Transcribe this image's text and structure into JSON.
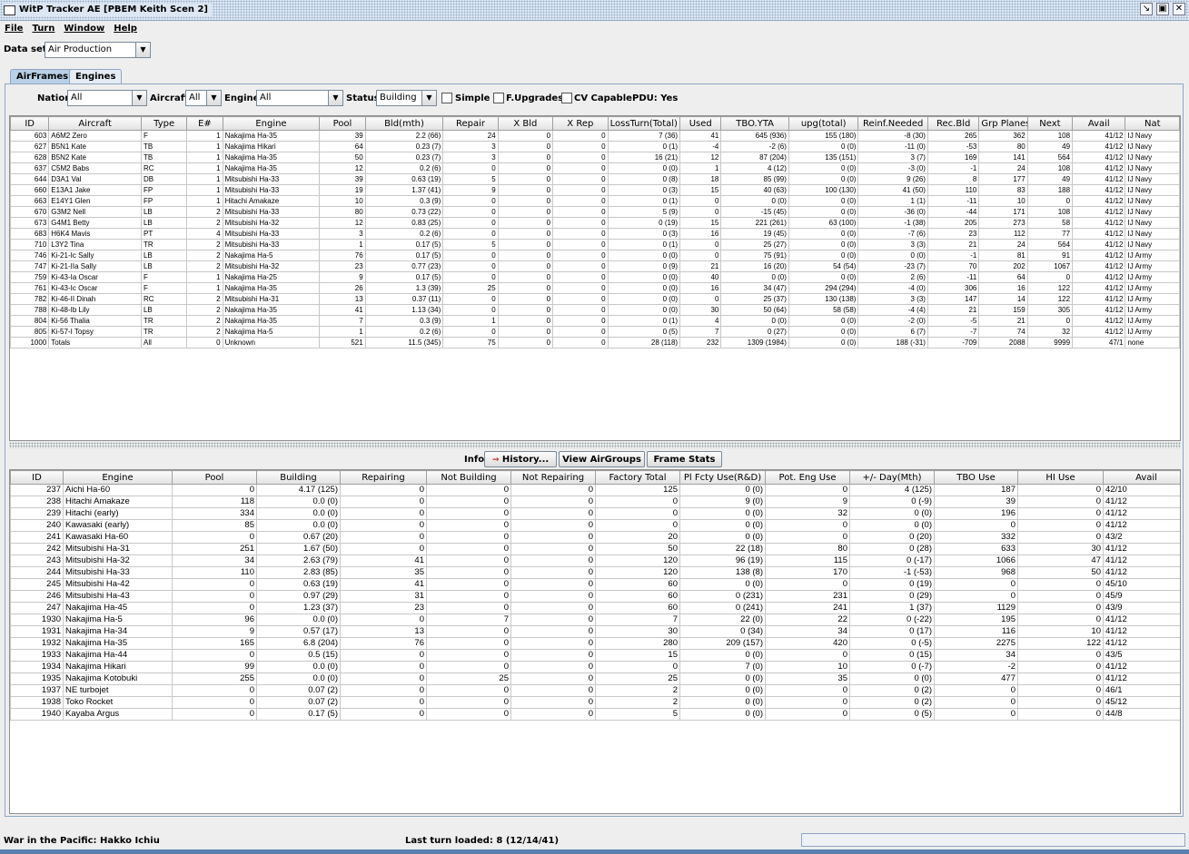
{
  "window": {
    "title": "WitP Tracker AE [PBEM Keith Scen 2]"
  },
  "menu": [
    "File",
    "Turn",
    "Window",
    "Help"
  ],
  "dataset": {
    "label": "Data set:",
    "value": "Air Production"
  },
  "tabs": [
    "AirFrames",
    "Engines"
  ],
  "filters": {
    "nation_label": "Nation:",
    "nation_value": "All",
    "aircraft_label": "Aircraft:",
    "aircraft_value": "All",
    "engine_label": "Engine:",
    "engine_value": "All",
    "status_label": "Status:",
    "status_value": "Building",
    "simple": "Simple",
    "fupgrades": "F.Upgrades",
    "cvcapable": "CV Capable",
    "pdu": "PDU: Yes"
  },
  "airframes": {
    "columns": [
      "ID",
      "Aircraft",
      "Type",
      "E#",
      "Engine",
      "Pool",
      "Bld(mth)",
      "Repair",
      "X Bld",
      "X Rep",
      "LossTurn(Total)",
      "Used",
      "TBO.YTA",
      "upg(total)",
      "Reinf.Needed",
      "Rec.Bld",
      "Grp Planes",
      "Next",
      "Avail",
      "Nat"
    ],
    "rows": [
      [
        "603",
        "A6M2 Zero",
        "F",
        "1",
        "Nakajima Ha-35",
        "39",
        "2.2 (66)",
        "24",
        "0",
        "0",
        "7 (36)",
        "41",
        "645 (936)",
        "155 (180)",
        "-8 (30)",
        "265",
        "362",
        "108",
        "41/12",
        "IJ Navy"
      ],
      [
        "627",
        "B5N1 Kate",
        "TB",
        "1",
        "Nakajima Hikari",
        "64",
        "0.23 (7)",
        "3",
        "0",
        "0",
        "0 (1)",
        "-4",
        "-2 (6)",
        "0 (0)",
        "-11 (0)",
        "-53",
        "80",
        "49",
        "41/12",
        "IJ Navy"
      ],
      [
        "628",
        "B5N2 Kate",
        "TB",
        "1",
        "Nakajima Ha-35",
        "50",
        "0.23 (7)",
        "3",
        "0",
        "0",
        "16 (21)",
        "12",
        "87 (204)",
        "135 (151)",
        "3 (7)",
        "169",
        "141",
        "564",
        "41/12",
        "IJ Navy"
      ],
      [
        "637",
        "C5M2 Babs",
        "RC",
        "1",
        "Nakajima Ha-35",
        "12",
        "0.2 (6)",
        "0",
        "0",
        "0",
        "0 (0)",
        "1",
        "4 (12)",
        "0 (0)",
        "-3 (0)",
        "-1",
        "24",
        "108",
        "41/12",
        "IJ Navy"
      ],
      [
        "644",
        "D3A1 Val",
        "DB",
        "1",
        "Mitsubishi Ha-33",
        "39",
        "0.63 (19)",
        "5",
        "0",
        "0",
        "0 (8)",
        "18",
        "85 (99)",
        "0 (0)",
        "9 (26)",
        "8",
        "177",
        "49",
        "41/12",
        "IJ Navy"
      ],
      [
        "660",
        "E13A1 Jake",
        "FP",
        "1",
        "Mitsubishi Ha-33",
        "19",
        "1.37 (41)",
        "9",
        "0",
        "0",
        "0 (3)",
        "15",
        "40 (63)",
        "100 (130)",
        "41 (50)",
        "110",
        "83",
        "188",
        "41/12",
        "IJ Navy"
      ],
      [
        "663",
        "E14Y1 Glen",
        "FP",
        "1",
        "Hitachi Amakaze",
        "10",
        "0.3 (9)",
        "0",
        "0",
        "0",
        "0 (1)",
        "0",
        "0 (0)",
        "0 (0)",
        "1 (1)",
        "-11",
        "10",
        "0",
        "41/12",
        "IJ Navy"
      ],
      [
        "670",
        "G3M2 Nell",
        "LB",
        "2",
        "Mitsubishi Ha-33",
        "80",
        "0.73 (22)",
        "0",
        "0",
        "0",
        "5 (9)",
        "0",
        "-15 (45)",
        "0 (0)",
        "-36 (0)",
        "-44",
        "171",
        "108",
        "41/12",
        "IJ Navy"
      ],
      [
        "673",
        "G4M1 Betty",
        "LB",
        "2",
        "Mitsubishi Ha-32",
        "12",
        "0.83 (25)",
        "0",
        "0",
        "0",
        "0 (19)",
        "15",
        "221 (261)",
        "63 (100)",
        "-1 (38)",
        "205",
        "273",
        "58",
        "41/12",
        "IJ Navy"
      ],
      [
        "683",
        "H6K4 Mavis",
        "PT",
        "4",
        "Mitsubishi Ha-33",
        "3",
        "0.2 (6)",
        "0",
        "0",
        "0",
        "0 (3)",
        "16",
        "19 (45)",
        "0 (0)",
        "-7 (6)",
        "23",
        "112",
        "77",
        "41/12",
        "IJ Navy"
      ],
      [
        "710",
        "L3Y2 Tina",
        "TR",
        "2",
        "Mitsubishi Ha-33",
        "1",
        "0.17 (5)",
        "5",
        "0",
        "0",
        "0 (1)",
        "0",
        "25 (27)",
        "0 (0)",
        "3 (3)",
        "21",
        "24",
        "564",
        "41/12",
        "IJ Navy"
      ],
      [
        "746",
        "Ki-21-Ic Sally",
        "LB",
        "2",
        "Nakajima Ha-5",
        "76",
        "0.17 (5)",
        "0",
        "0",
        "0",
        "0 (0)",
        "0",
        "75 (91)",
        "0 (0)",
        "0 (0)",
        "-1",
        "81",
        "91",
        "41/12",
        "IJ Army"
      ],
      [
        "747",
        "Ki-21-IIa Sally",
        "LB",
        "2",
        "Mitsubishi Ha-32",
        "23",
        "0.77 (23)",
        "0",
        "0",
        "0",
        "0 (9)",
        "21",
        "16 (20)",
        "54 (54)",
        "-23 (7)",
        "70",
        "202",
        "1067",
        "41/12",
        "IJ Army"
      ],
      [
        "759",
        "Ki-43-Ia Oscar",
        "F",
        "1",
        "Nakajima Ha-25",
        "9",
        "0.17 (5)",
        "0",
        "0",
        "0",
        "0 (0)",
        "40",
        "0 (0)",
        "0 (0)",
        "2 (6)",
        "-11",
        "64",
        "0",
        "41/12",
        "IJ Army"
      ],
      [
        "761",
        "Ki-43-Ic Oscar",
        "F",
        "1",
        "Nakajima Ha-35",
        "26",
        "1.3 (39)",
        "25",
        "0",
        "0",
        "0 (0)",
        "16",
        "34 (47)",
        "294 (294)",
        "-4 (0)",
        "306",
        "16",
        "122",
        "41/12",
        "IJ Army"
      ],
      [
        "782",
        "Ki-46-II Dinah",
        "RC",
        "2",
        "Mitsubishi Ha-31",
        "13",
        "0.37 (11)",
        "0",
        "0",
        "0",
        "0 (0)",
        "0",
        "25 (37)",
        "130 (138)",
        "3 (3)",
        "147",
        "14",
        "122",
        "41/12",
        "IJ Army"
      ],
      [
        "788",
        "Ki-48-Ib Lily",
        "LB",
        "2",
        "Nakajima Ha-35",
        "41",
        "1.13 (34)",
        "0",
        "0",
        "0",
        "0 (0)",
        "30",
        "50 (64)",
        "58 (58)",
        "-4 (4)",
        "21",
        "159",
        "305",
        "41/12",
        "IJ Army"
      ],
      [
        "804",
        "Ki-56 Thalia",
        "TR",
        "2",
        "Nakajima Ha-35",
        "7",
        "0.3 (9)",
        "1",
        "0",
        "0",
        "0 (1)",
        "4",
        "0 (0)",
        "0 (0)",
        "-2 (0)",
        "-5",
        "21",
        "0",
        "41/12",
        "IJ Army"
      ],
      [
        "805",
        "Ki-57-I Topsy",
        "TR",
        "2",
        "Nakajima Ha-5",
        "1",
        "0.2 (6)",
        "0",
        "0",
        "0",
        "0 (5)",
        "7",
        "0 (27)",
        "0 (0)",
        "6 (7)",
        "-7",
        "74",
        "32",
        "41/12",
        "IJ Army"
      ],
      [
        "1000",
        "Totals",
        "All",
        "0",
        "Unknown",
        "521",
        "11.5 (345)",
        "75",
        "0",
        "0",
        "28 (118)",
        "232",
        "1309 (1984)",
        "0 (0)",
        "188 (-31)",
        "-709",
        "2088",
        "9999",
        "47/1",
        "none"
      ]
    ]
  },
  "info": {
    "label": "Info:",
    "history": "History...",
    "view_airgroups": "View AirGroups",
    "frame_stats": "Frame Stats"
  },
  "engines": {
    "columns": [
      "ID",
      "Engine",
      "Pool",
      "Building",
      "Repairing",
      "Not Building",
      "Not Repairing",
      "Factory Total",
      "Pl Fcty Use(R&D)",
      "Pot. Eng Use",
      "+/- Day(Mth)",
      "TBO Use",
      "HI Use",
      "Avail"
    ],
    "rows": [
      [
        "237",
        "Aichi Ha-60",
        "0",
        "4.17 (125)",
        "0",
        "0",
        "0",
        "125",
        "0 (0)",
        "0",
        "4 (125)",
        "187",
        "0",
        "42/10"
      ],
      [
        "238",
        "Hitachi Amakaze",
        "118",
        "0.0 (0)",
        "0",
        "0",
        "0",
        "0",
        "9 (0)",
        "9",
        "0 (-9)",
        "39",
        "0",
        "41/12"
      ],
      [
        "239",
        "Hitachi (early)",
        "334",
        "0.0 (0)",
        "0",
        "0",
        "0",
        "0",
        "0 (0)",
        "32",
        "0 (0)",
        "196",
        "0",
        "41/12"
      ],
      [
        "240",
        "Kawasaki (early)",
        "85",
        "0.0 (0)",
        "0",
        "0",
        "0",
        "0",
        "0 (0)",
        "0",
        "0 (0)",
        "0",
        "0",
        "41/12"
      ],
      [
        "241",
        "Kawasaki Ha-60",
        "0",
        "0.67 (20)",
        "0",
        "0",
        "0",
        "20",
        "0 (0)",
        "0",
        "0 (20)",
        "332",
        "0",
        "43/2"
      ],
      [
        "242",
        "Mitsubishi Ha-31",
        "251",
        "1.67 (50)",
        "0",
        "0",
        "0",
        "50",
        "22 (18)",
        "80",
        "0 (28)",
        "633",
        "30",
        "41/12"
      ],
      [
        "243",
        "Mitsubishi Ha-32",
        "34",
        "2.63 (79)",
        "41",
        "0",
        "0",
        "120",
        "96 (19)",
        "115",
        "0 (-17)",
        "1066",
        "47",
        "41/12"
      ],
      [
        "244",
        "Mitsubishi Ha-33",
        "110",
        "2.83 (85)",
        "35",
        "0",
        "0",
        "120",
        "138 (8)",
        "170",
        "-1 (-53)",
        "968",
        "50",
        "41/12"
      ],
      [
        "245",
        "Mitsubishi Ha-42",
        "0",
        "0.63 (19)",
        "41",
        "0",
        "0",
        "60",
        "0 (0)",
        "0",
        "0 (19)",
        "0",
        "0",
        "45/10"
      ],
      [
        "246",
        "Mitsubishi Ha-43",
        "0",
        "0.97 (29)",
        "31",
        "0",
        "0",
        "60",
        "0 (231)",
        "231",
        "0 (29)",
        "0",
        "0",
        "45/9"
      ],
      [
        "247",
        "Nakajima Ha-45",
        "0",
        "1.23 (37)",
        "23",
        "0",
        "0",
        "60",
        "0 (241)",
        "241",
        "1 (37)",
        "1129",
        "0",
        "43/9"
      ],
      [
        "1930",
        "Nakajima Ha-5",
        "96",
        "0.0 (0)",
        "0",
        "7",
        "0",
        "7",
        "22 (0)",
        "22",
        "0 (-22)",
        "195",
        "0",
        "41/12"
      ],
      [
        "1931",
        "Nakajima Ha-34",
        "9",
        "0.57 (17)",
        "13",
        "0",
        "0",
        "30",
        "0 (34)",
        "34",
        "0 (17)",
        "116",
        "10",
        "41/12"
      ],
      [
        "1932",
        "Nakajima Ha-35",
        "165",
        "6.8 (204)",
        "76",
        "0",
        "0",
        "280",
        "209 (157)",
        "420",
        "0 (-5)",
        "2275",
        "122",
        "41/12"
      ],
      [
        "1933",
        "Nakajima Ha-44",
        "0",
        "0.5 (15)",
        "0",
        "0",
        "0",
        "15",
        "0 (0)",
        "0",
        "0 (15)",
        "34",
        "0",
        "43/5"
      ],
      [
        "1934",
        "Nakajima Hikari",
        "99",
        "0.0 (0)",
        "0",
        "0",
        "0",
        "0",
        "7 (0)",
        "10",
        "0 (-7)",
        "-2",
        "0",
        "41/12"
      ],
      [
        "1935",
        "Nakajima Kotobuki",
        "255",
        "0.0 (0)",
        "0",
        "25",
        "0",
        "25",
        "0 (0)",
        "35",
        "0 (0)",
        "477",
        "0",
        "41/12"
      ],
      [
        "1937",
        "NE turbojet",
        "0",
        "0.07 (2)",
        "0",
        "0",
        "0",
        "2",
        "0 (0)",
        "0",
        "0 (2)",
        "0",
        "0",
        "46/1"
      ],
      [
        "1938",
        "Toko Rocket",
        "0",
        "0.07 (2)",
        "0",
        "0",
        "0",
        "2",
        "0 (0)",
        "0",
        "0 (2)",
        "0",
        "0",
        "45/12"
      ],
      [
        "1940",
        "Kayaba Argus",
        "0",
        "0.17 (5)",
        "0",
        "0",
        "0",
        "5",
        "0 (0)",
        "0",
        "0 (5)",
        "0",
        "0",
        "44/8"
      ]
    ]
  },
  "status": {
    "left": "War in the Pacific: Hakko Ichiu",
    "center": "Last turn loaded: 8 (12/14/41)"
  }
}
